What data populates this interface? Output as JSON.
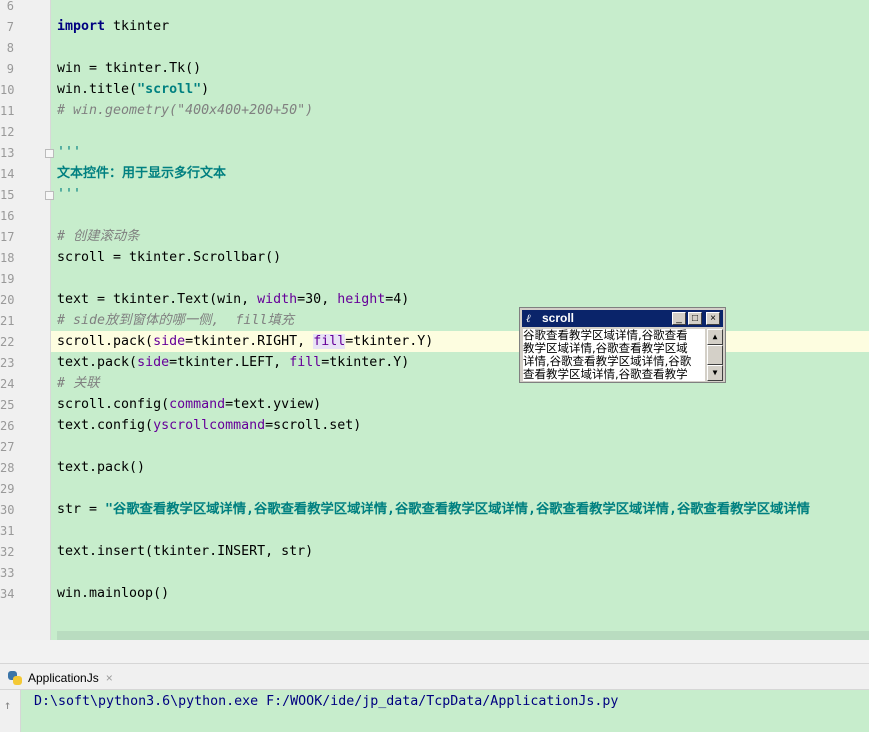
{
  "editor": {
    "lines": [
      {
        "num": "6"
      },
      {
        "num": "7"
      },
      {
        "num": "8"
      },
      {
        "num": "9"
      },
      {
        "num": "10"
      },
      {
        "num": "11"
      },
      {
        "num": "12"
      },
      {
        "num": "13"
      },
      {
        "num": "14"
      },
      {
        "num": "15"
      },
      {
        "num": "16"
      },
      {
        "num": "17"
      },
      {
        "num": "18"
      },
      {
        "num": "19"
      },
      {
        "num": "20"
      },
      {
        "num": "21"
      },
      {
        "num": "22"
      },
      {
        "num": "23"
      },
      {
        "num": "24"
      },
      {
        "num": "25"
      },
      {
        "num": "26"
      },
      {
        "num": "27"
      },
      {
        "num": "28"
      },
      {
        "num": "29"
      },
      {
        "num": "30"
      },
      {
        "num": "31"
      },
      {
        "num": "32"
      },
      {
        "num": "33"
      },
      {
        "num": "34"
      }
    ],
    "code": {
      "l7_kw": "import",
      "l7_rest": " tkinter",
      "l9": "win = tkinter.Tk()",
      "l10_a": "win.title(",
      "l10_s": "\"scroll\"",
      "l10_b": ")",
      "l11": "# win.geometry(\"400x400+200+50\")",
      "l13": "'''",
      "l14": "文本控件：用于显示多行文本",
      "l15": "'''",
      "l17": "# 创建滚动条",
      "l18": "scroll = tkinter.Scrollbar()",
      "l20_a": "text = tkinter.Text(win, ",
      "l20_p1": "width",
      "l20_b": "=30, ",
      "l20_p2": "height",
      "l20_c": "=4)",
      "l21": "# side放到窗体的哪一侧,  fill填充",
      "l22_a": "scroll.pack(",
      "l22_p1": "side",
      "l22_b": "=tkinter.RIGHT, ",
      "l22_p2": "fill",
      "l22_c": "=tkinter.Y)",
      "l23_a": "text.pack(",
      "l23_p1": "side",
      "l23_b": "=tkinter.LEFT, ",
      "l23_p2": "fill",
      "l23_c": "=tkinter.Y)",
      "l24": "# 关联",
      "l25_a": "scroll.config(",
      "l25_p": "command",
      "l25_b": "=text.yview)",
      "l26_a": "text.config(",
      "l26_p": "yscrollcommand",
      "l26_b": "=scroll.set)",
      "l28": "text.pack()",
      "l30_a": "str = ",
      "l30_s": "\"谷歌查看教学区域详情,谷歌查看教学区域详情,谷歌查看教学区域详情,谷歌查看教学区域详情,谷歌查看教学区域详情",
      "l32": "text.insert(tkinter.INSERT, str)",
      "l34": "win.mainloop()"
    }
  },
  "tk_window": {
    "title": "scroll",
    "text_lines": [
      "谷歌查看教学区域详情,谷歌查看",
      "教学区域详情,谷歌查看教学区域",
      "详情,谷歌查看教学区域详情,谷歌",
      "查看教学区域详情,谷歌查看教学"
    ],
    "minimize": "_",
    "maximize": "□",
    "close": "×"
  },
  "run_panel": {
    "tab_label": "ApplicationJs",
    "close": "×",
    "output": "D:\\soft\\python3.6\\python.exe F:/WOOK/ide/jp_data/TcpData/ApplicationJs.py"
  }
}
